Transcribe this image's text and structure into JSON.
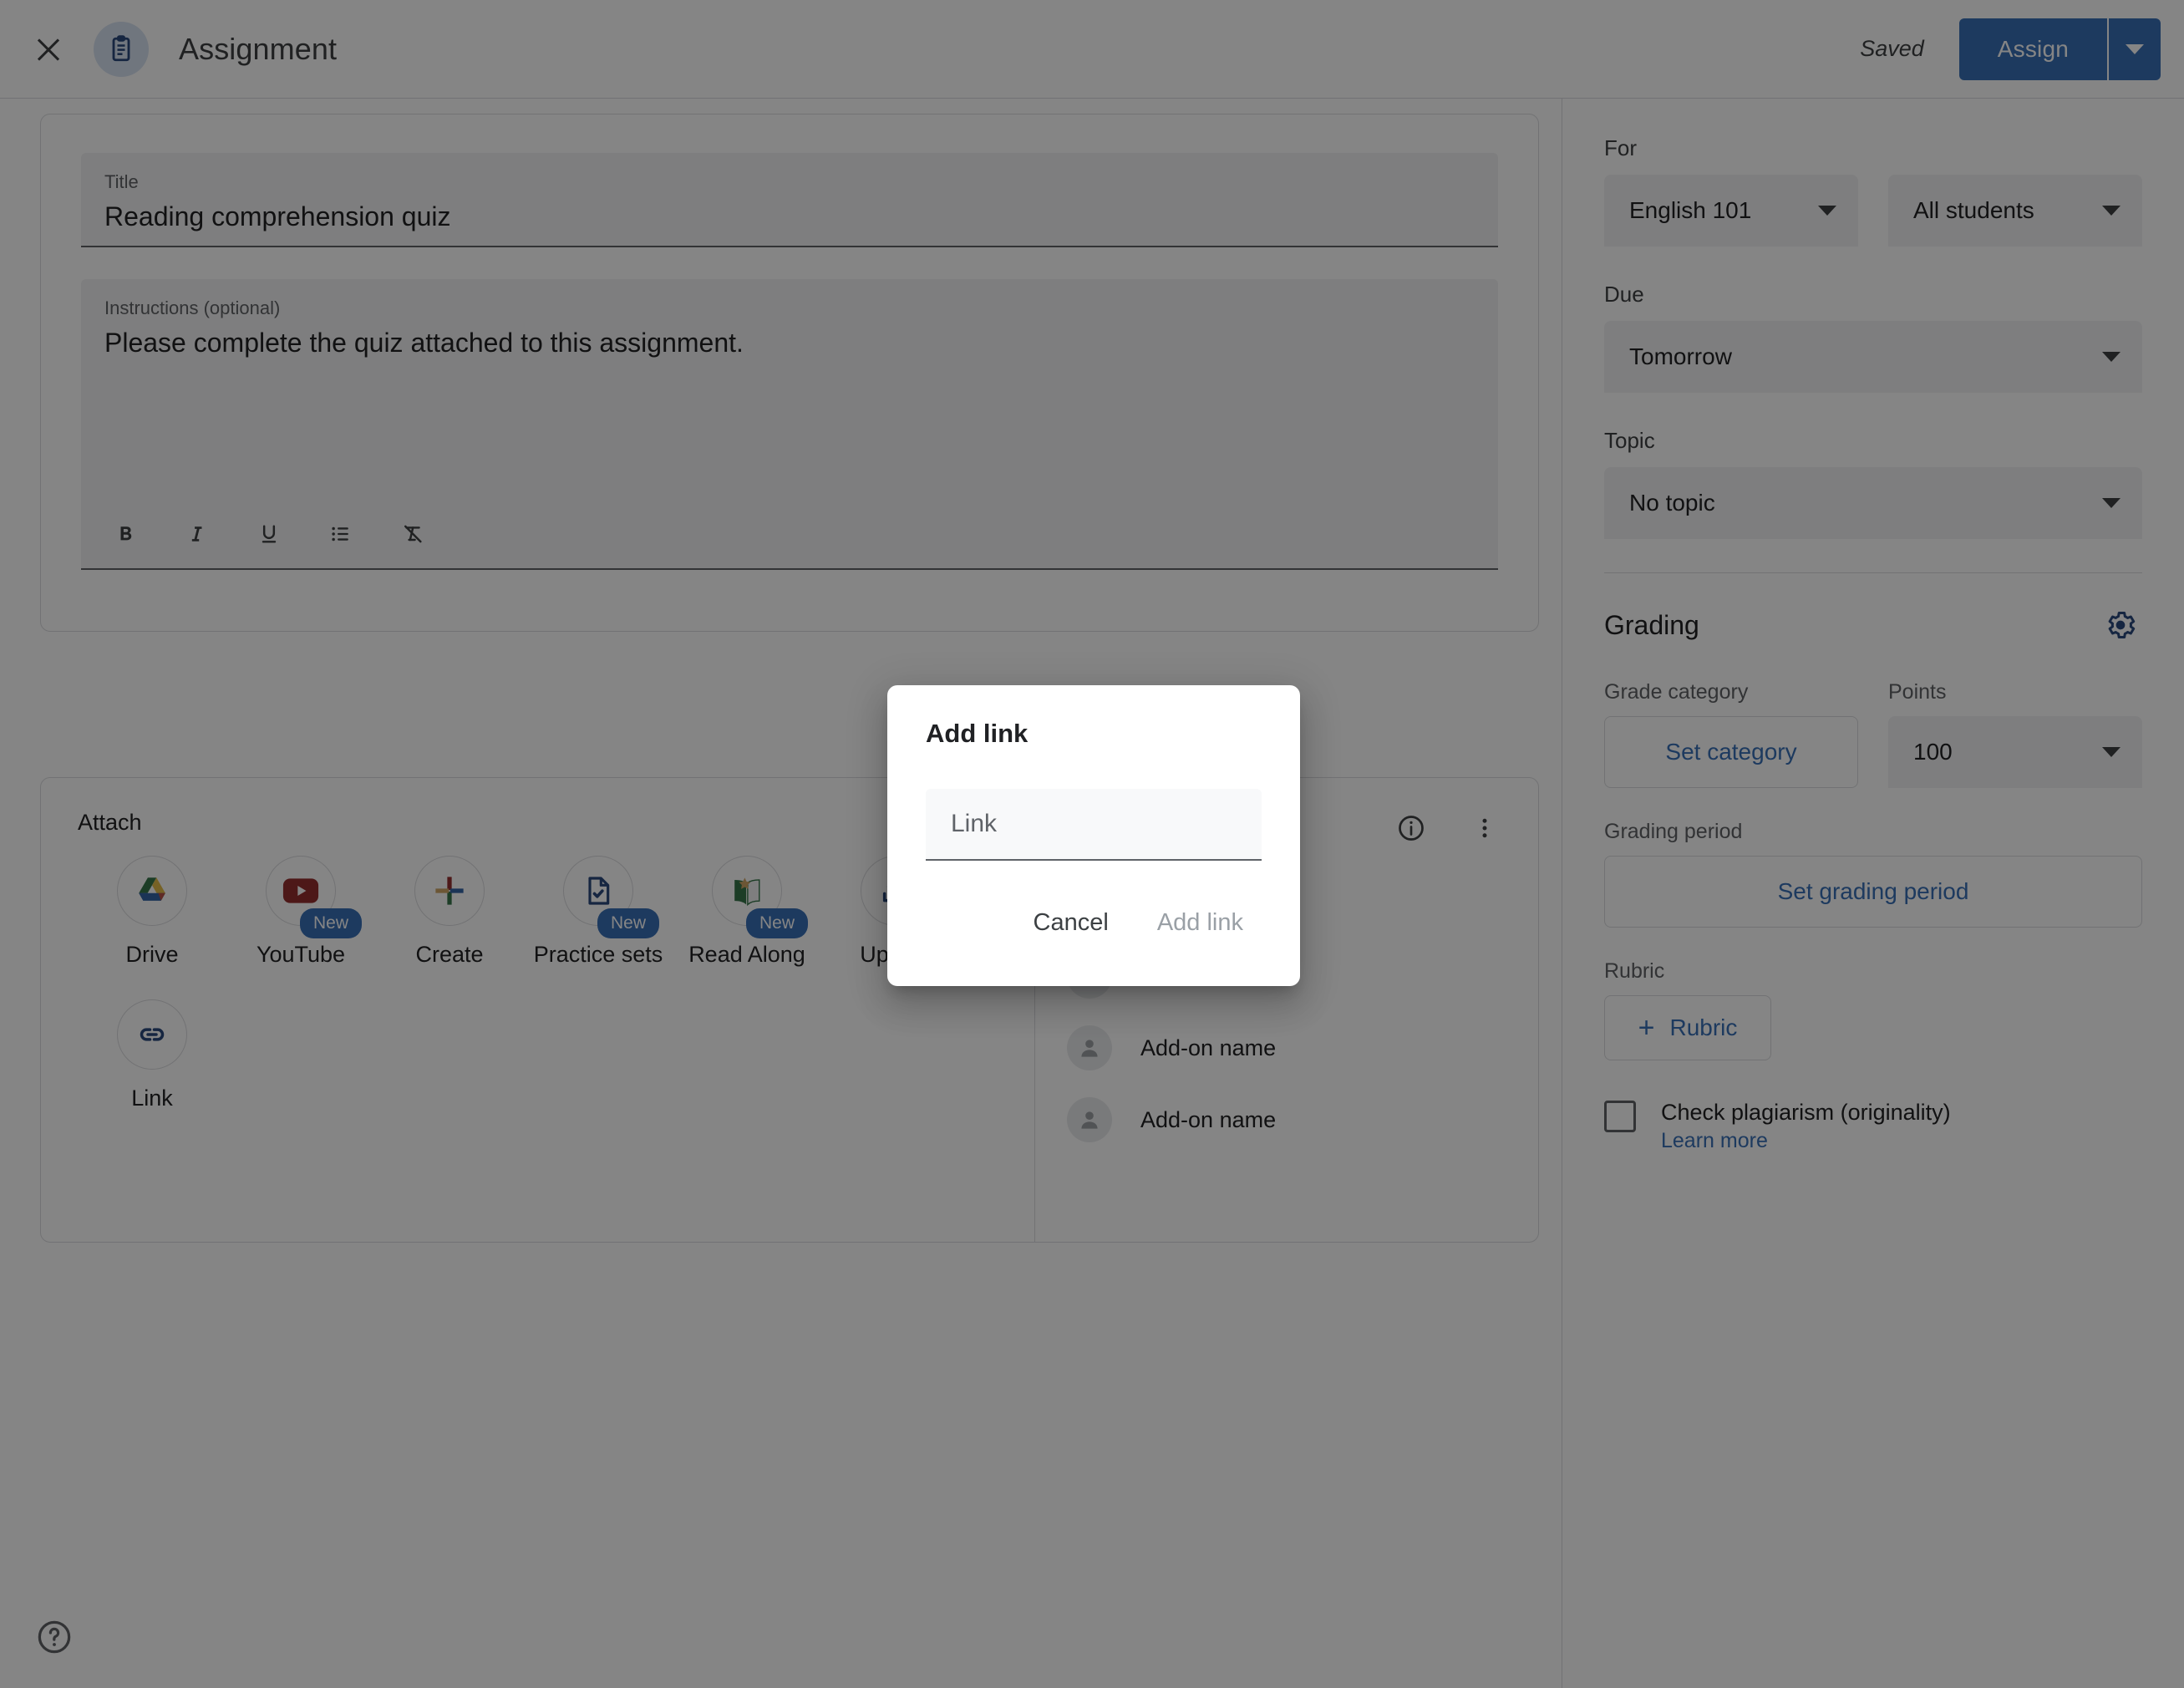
{
  "header": {
    "close_icon": "close-icon",
    "doc_icon": "assignment-clipboard-icon",
    "title": "Assignment",
    "saved_status": "Saved",
    "assign_label": "Assign",
    "assign_caret_icon": "chevron-down-icon",
    "accent_color": "#1a73e8"
  },
  "form": {
    "title_field": {
      "label": "Title",
      "value": "Reading comprehension quiz"
    },
    "instructions_field": {
      "label": "Instructions (optional)",
      "value": "Please complete the quiz attached to this assignment."
    },
    "format_tools": [
      {
        "name": "bold-icon",
        "glyph": "B"
      },
      {
        "name": "italic-icon",
        "glyph": "I"
      },
      {
        "name": "underline-icon",
        "glyph": "U"
      },
      {
        "name": "bulleted-list-icon",
        "glyph": "list"
      },
      {
        "name": "clear-formatting-icon",
        "glyph": "clear"
      }
    ]
  },
  "attach": {
    "label": "Attach",
    "items": [
      {
        "label": "Drive",
        "icon": "google-drive-icon",
        "badge": ""
      },
      {
        "label": "YouTube",
        "icon": "youtube-icon",
        "badge": "New"
      },
      {
        "label": "Create",
        "icon": "create-plus-icon",
        "badge": ""
      },
      {
        "label": "Practice sets",
        "icon": "practice-sets-icon",
        "badge": "New"
      },
      {
        "label": "Read Along",
        "icon": "read-along-icon",
        "badge": "New"
      },
      {
        "label": "Upload",
        "icon": "upload-icon",
        "badge": ""
      }
    ],
    "items_row2": [
      {
        "label": "Link",
        "icon": "link-icon",
        "badge": ""
      }
    ],
    "addons": {
      "info_icon": "info-icon",
      "more_icon": "more-vert-icon",
      "list": [
        {
          "label": "Add-on name",
          "avatar": "person-avatar-icon"
        },
        {
          "label": "Add-on name",
          "avatar": "person-avatar-icon"
        },
        {
          "label": "Add-on name",
          "avatar": "person-avatar-icon"
        },
        {
          "label": "Add-on name",
          "avatar": "person-avatar-icon"
        }
      ]
    }
  },
  "help": {
    "icon": "help-circle-icon"
  },
  "sidebar": {
    "for": {
      "label": "For",
      "course": {
        "value": "English 101",
        "caret_icon": "chevron-down-icon"
      },
      "students": {
        "value": "All students",
        "caret_icon": "chevron-down-icon"
      }
    },
    "due": {
      "label": "Due",
      "value": "Tomorrow",
      "caret_icon": "chevron-down-icon"
    },
    "topic": {
      "label": "Topic",
      "value": "No topic",
      "caret_icon": "chevron-down-icon"
    },
    "grading": {
      "title": "Grading",
      "settings_icon": "gear-icon",
      "grade_category": {
        "label": "Grade category",
        "button": "Set category"
      },
      "points": {
        "label": "Points",
        "value": "100",
        "caret_icon": "chevron-down-icon"
      },
      "grading_period": {
        "label": "Grading period",
        "button": "Set grading period"
      },
      "rubric": {
        "label": "Rubric",
        "button": "Rubric",
        "plus_icon": "plus-icon"
      },
      "plagiarism": {
        "checkbox_icon": "checkbox-unchecked-icon",
        "label": "Check plagiarism (originality)",
        "learn_more": "Learn more"
      }
    }
  },
  "modal": {
    "title": "Add link",
    "field_placeholder": "Link",
    "field_value": "",
    "cancel_label": "Cancel",
    "submit_label": "Add link",
    "submit_disabled": true
  }
}
